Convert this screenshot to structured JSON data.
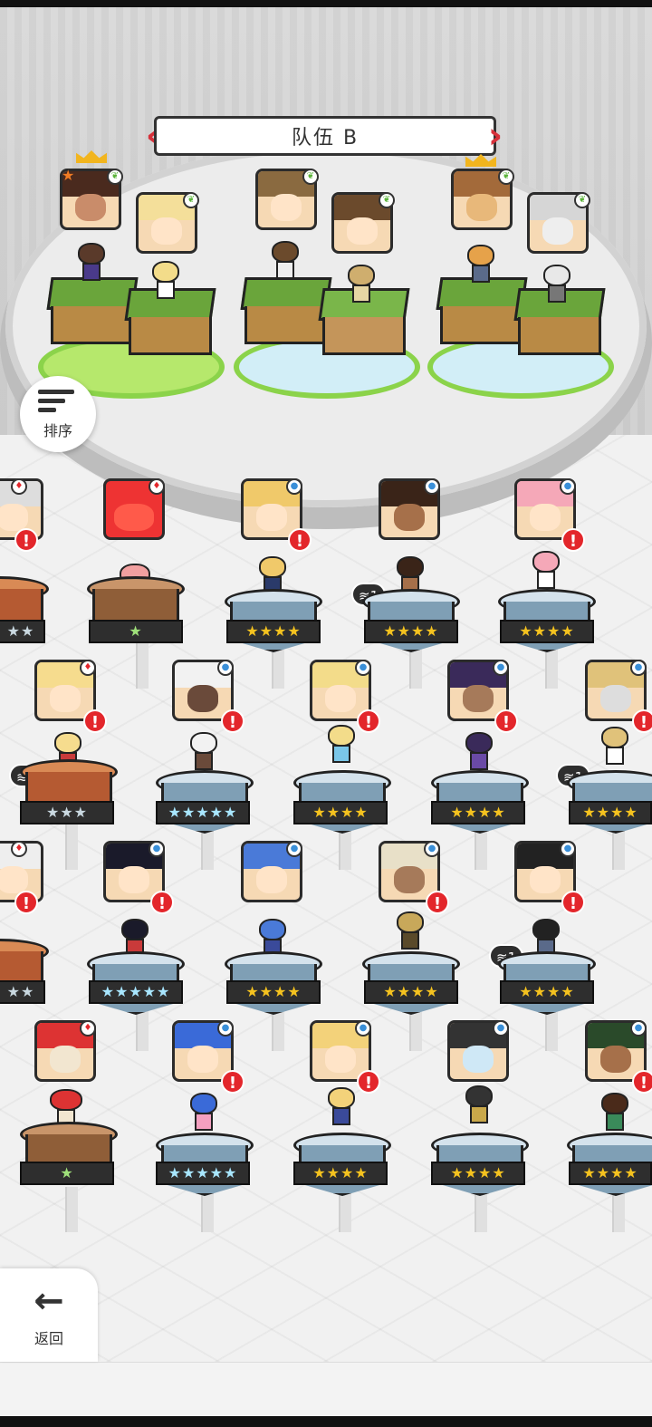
{
  "team": {
    "name": "队伍 B"
  },
  "buttons": {
    "sort_label": "排序",
    "back_label": "返回"
  },
  "icons": {
    "prev_team": "chevron-left-icon",
    "next_team": "chevron-right-icon",
    "sort": "sort-descending-icon",
    "back": "arrow-left-icon"
  },
  "colors": {
    "alert": "#e3262b",
    "star": "#f4c21f",
    "pad_green": "#8bd34a",
    "banner_arrow": "#d7303a"
  },
  "roster_rows": [
    {
      "units": [
        {
          "stars": "★★",
          "dupe": null
        },
        {
          "stars": "★",
          "dupe": null
        },
        {
          "stars": "★★★★",
          "dupe": null
        },
        {
          "stars": "★★★★",
          "dupe": "1"
        },
        {
          "stars": "★★★★",
          "dupe": null
        }
      ]
    },
    {
      "units": [
        {
          "stars": "★★★",
          "dupe": "2"
        },
        {
          "stars": "★★★★★",
          "dupe": null
        },
        {
          "stars": "★★★★",
          "dupe": null
        },
        {
          "stars": "★★★★",
          "dupe": null
        },
        {
          "stars": "★★★★",
          "dupe": "1"
        }
      ]
    },
    {
      "units": [
        {
          "stars": "★★",
          "dupe": null
        },
        {
          "stars": "★★★★★",
          "dupe": null
        },
        {
          "stars": "★★★★",
          "dupe": null
        },
        {
          "stars": "★★★★",
          "dupe": null
        },
        {
          "stars": "★★★★",
          "dupe": "1"
        }
      ]
    },
    {
      "units": [
        {
          "stars": "★",
          "dupe": null
        },
        {
          "stars": "★★★★★",
          "dupe": null
        },
        {
          "stars": "★★★★",
          "dupe": null
        },
        {
          "stars": "★★★★",
          "dupe": null
        },
        {
          "stars": "★★★★",
          "dupe": null
        }
      ]
    }
  ],
  "alert_glyph": "!"
}
